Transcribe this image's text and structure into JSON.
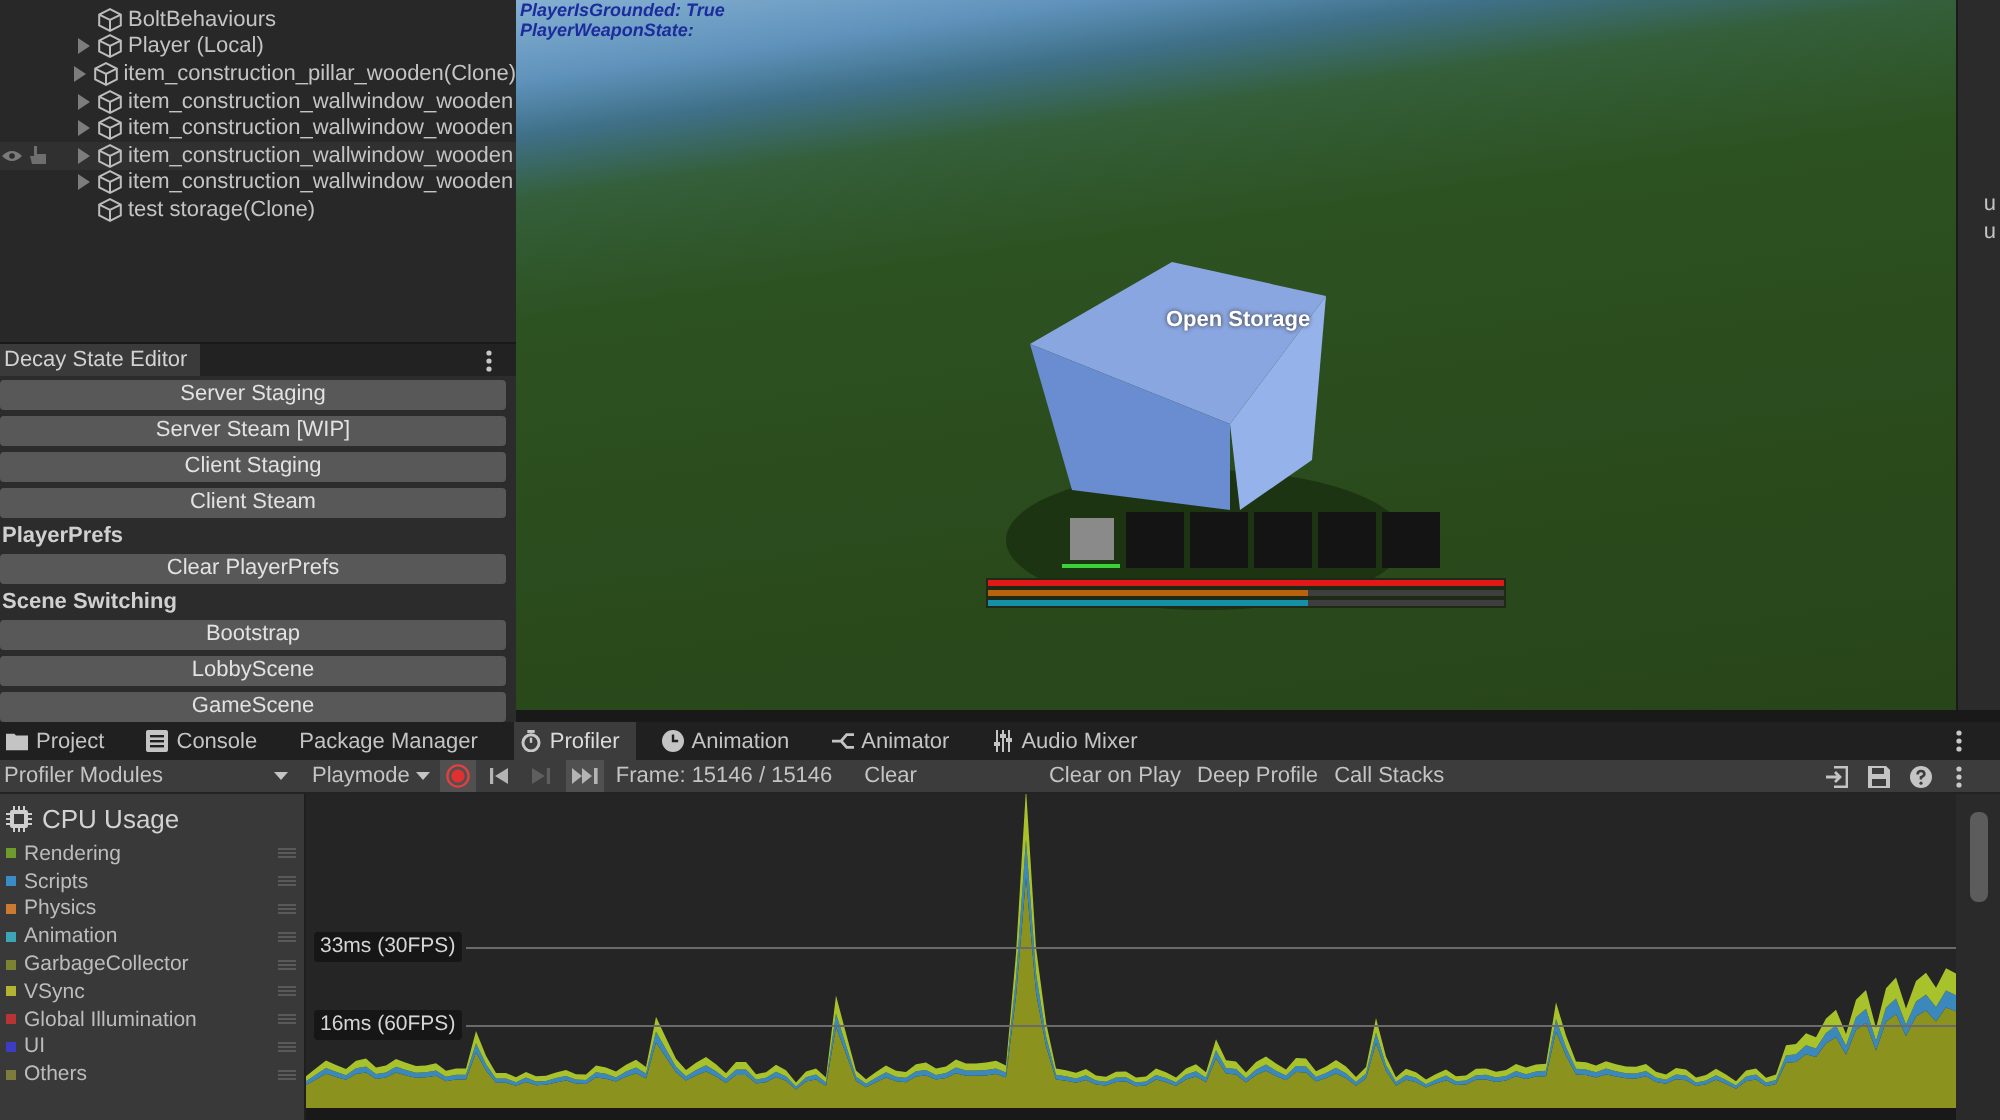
{
  "hierarchy": {
    "items": [
      {
        "name": "BoltBehaviours",
        "has_children": false,
        "hovered": false
      },
      {
        "name": "Player (Local)",
        "has_children": true,
        "hovered": false
      },
      {
        "name": "item_construction_pillar_wooden(Clone)",
        "has_children": true,
        "hovered": false
      },
      {
        "name": "item_construction_wallwindow_wooden",
        "has_children": true,
        "hovered": false
      },
      {
        "name": "item_construction_wallwindow_wooden",
        "has_children": true,
        "hovered": false
      },
      {
        "name": "item_construction_wallwindow_wooden",
        "has_children": true,
        "hovered": true
      },
      {
        "name": "item_construction_wallwindow_wooden",
        "has_children": true,
        "hovered": false
      },
      {
        "name": "test storage(Clone)",
        "has_children": false,
        "hovered": false
      }
    ]
  },
  "decay_editor": {
    "title": "Decay State Editor",
    "items": [
      {
        "kind": "button",
        "label": "Server Staging"
      },
      {
        "kind": "button",
        "label": "Server Steam [WIP]"
      },
      {
        "kind": "button",
        "label": "Client Staging"
      },
      {
        "kind": "button",
        "label": "Client Steam"
      },
      {
        "kind": "heading",
        "label": "PlayerPrefs"
      },
      {
        "kind": "button",
        "label": "Clear PlayerPrefs"
      },
      {
        "kind": "heading",
        "label": "Scene Switching"
      },
      {
        "kind": "button",
        "label": "Bootstrap"
      },
      {
        "kind": "button",
        "label": "LobbyScene"
      },
      {
        "kind": "button",
        "label": "GameScene"
      }
    ]
  },
  "game_view": {
    "debug_lines": [
      "PlayerIsGrounded: True",
      "PlayerWeaponState:"
    ],
    "prompt": "Open Storage",
    "hotbar": [
      {
        "selected": true,
        "filled": true
      },
      {
        "selected": false,
        "filled": false
      },
      {
        "selected": false,
        "filled": false
      },
      {
        "selected": false,
        "filled": false
      },
      {
        "selected": false,
        "filled": false
      },
      {
        "selected": false,
        "filled": false
      }
    ],
    "bars": [
      {
        "color": "#e01818",
        "level": 1.0
      },
      {
        "color": "#b8620e",
        "level": 0.62
      },
      {
        "color": "#1590a8",
        "level": 0.62
      }
    ]
  },
  "inspector": {
    "labels": [
      "u",
      "u"
    ]
  },
  "bottom_panel": {
    "tabs": [
      {
        "label": "Project",
        "selected": false
      },
      {
        "label": "Console",
        "selected": false
      },
      {
        "label": "Package Manager",
        "selected": false
      },
      {
        "label": "Profiler",
        "selected": true
      },
      {
        "label": "Animation",
        "selected": false
      },
      {
        "label": "Animator",
        "selected": false
      },
      {
        "label": "Audio Mixer",
        "selected": false
      }
    ]
  },
  "profiler_toolbar": {
    "modules_dropdown": "Profiler Modules",
    "target_dropdown": "Playmode",
    "record": {
      "on": true
    },
    "frame_controls": [
      {
        "disabled": false,
        "selected": false
      },
      {
        "disabled": true,
        "selected": false
      },
      {
        "disabled": false,
        "selected": true
      }
    ],
    "frame_label": "Frame: 15146 / 15146",
    "buttons": [
      "Clear",
      "Clear on Play",
      "Deep Profile",
      "Call Stacks"
    ]
  },
  "profiler": {
    "module_title": "CPU Usage",
    "legend": [
      {
        "label": "Rendering",
        "color": "#6f9a2c"
      },
      {
        "label": "Scripts",
        "color": "#3a8cc4"
      },
      {
        "label": "Physics",
        "color": "#cc7a30"
      },
      {
        "label": "Animation",
        "color": "#3ea4b8"
      },
      {
        "label": "GarbageCollector",
        "color": "#7c8232"
      },
      {
        "label": "VSync",
        "color": "#b4b432"
      },
      {
        "label": "Global Illumination",
        "color": "#b83434"
      },
      {
        "label": "UI",
        "color": "#3c3cc4"
      },
      {
        "label": "Others",
        "color": "#7e7c3a"
      }
    ],
    "thresholds": [
      "33ms (30FPS)",
      "16ms (60FPS)"
    ]
  }
}
